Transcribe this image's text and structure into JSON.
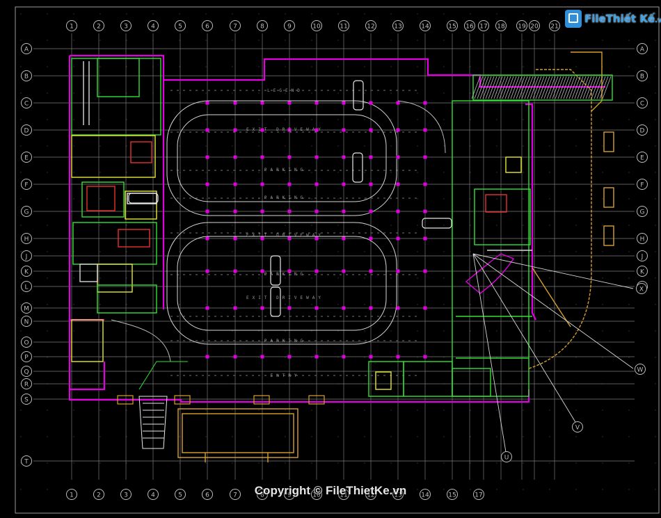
{
  "watermark": {
    "brand_file": "File",
    "brand_rest": "Thiết Kế",
    "brand_domain": ".vn",
    "copyright": "Copyright © FileThietKe.vn"
  },
  "grid": {
    "columns": [
      "1",
      "2",
      "3",
      "4",
      "5",
      "6",
      "7",
      "8",
      "9",
      "10",
      "11",
      "12",
      "13",
      "14",
      "15",
      "16",
      "17",
      "18",
      "19",
      "20",
      "21"
    ],
    "bottom_columns": [
      "1",
      "2",
      "3",
      "4",
      "5",
      "6",
      "7",
      "8",
      "9",
      "10",
      "11",
      "12",
      "13",
      "14",
      "15",
      "17"
    ],
    "rows": [
      "A",
      "B",
      "C",
      "D",
      "E",
      "F",
      "G",
      "H",
      "J",
      "K",
      "L",
      "M",
      "N",
      "O",
      "P",
      "Q",
      "R",
      "S",
      "T"
    ],
    "callouts": [
      "X",
      "W",
      "V",
      "U"
    ]
  },
  "parking": {
    "lane_labels": [
      "LEGEND",
      "EXIT DRIVEWAY",
      "PARKING",
      "PARKING",
      "EXIT DRIVEWAY",
      "PARKING",
      "EXIT DRIVEWAY",
      "PARKING",
      "ENTRY"
    ]
  },
  "colors": {
    "grid": "#7a7a7a",
    "bubble": "#bdbdbd",
    "wall": "#e000e0",
    "green": "#34e034",
    "yellow": "#e8e834",
    "red": "#e83030",
    "orange": "#d8a030",
    "white": "#e8e8e8",
    "cyan": "#34c8d8"
  }
}
